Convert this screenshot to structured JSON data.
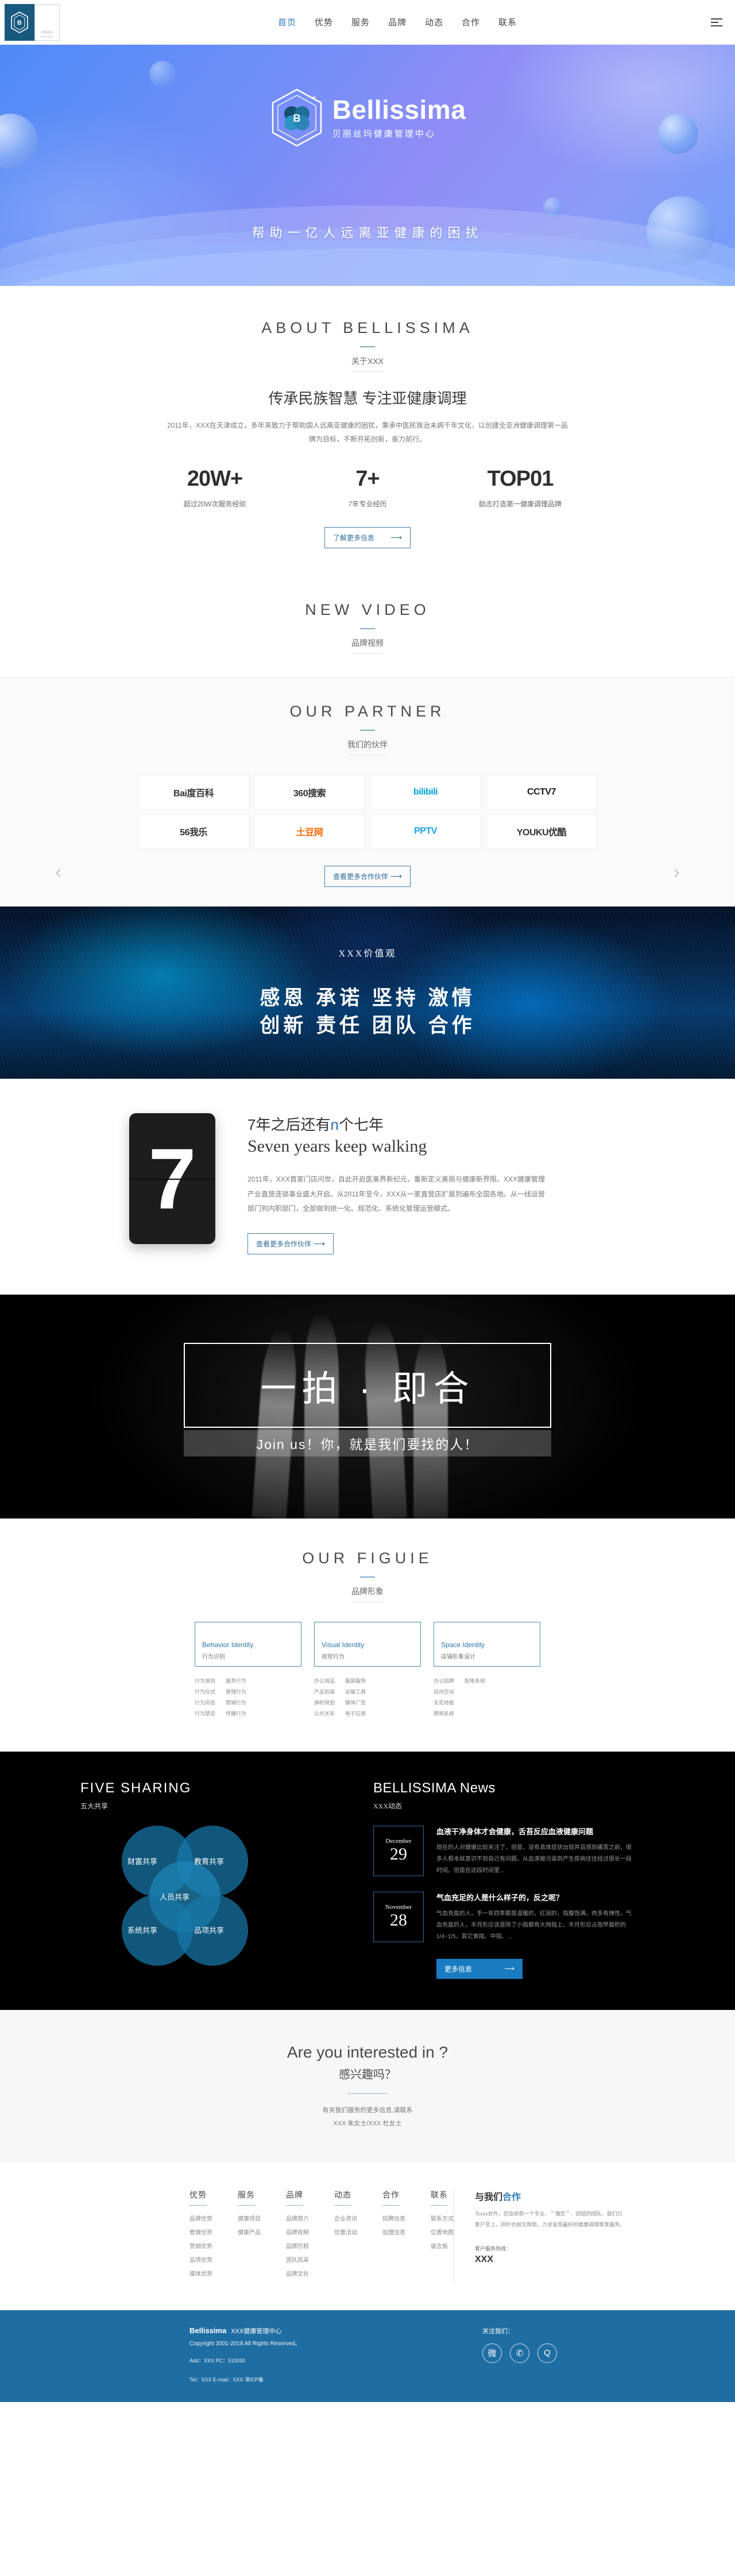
{
  "header": {
    "logo_brand": "Bellissima",
    "logo_cn": "贝丽丝玛",
    "logo_since": "Since 2011",
    "nav": [
      {
        "label": "首页",
        "active": true
      },
      {
        "label": "优势",
        "active": false
      },
      {
        "label": "服务",
        "active": false
      },
      {
        "label": "品牌",
        "active": false
      },
      {
        "label": "动态",
        "active": false
      },
      {
        "label": "合作",
        "active": false
      },
      {
        "label": "联系",
        "active": false
      }
    ]
  },
  "hero": {
    "brand_name": "Bellissima",
    "brand_cn": "贝丽丝玛健康管理中心",
    "slogan": "帮助一亿人远离亚健康的困扰"
  },
  "about": {
    "title": "ABOUT BELLISSIMA",
    "subtitle": "关于XXX",
    "heading": "传承民族智慧 专注亚健康调理",
    "desc": "2011年，XXX在天津成立，多年来致力于帮助国人远离亚健康的困扰，秉承中医民族治未病千年文化，以创建全亚洲健康调理第一品牌为目标，不断开拓创新，奋力前行。",
    "stats": [
      {
        "num": "20W+",
        "cap": "超过20W次服务经验"
      },
      {
        "num": "7+",
        "cap": "7年专业经历"
      },
      {
        "num": "TOP01",
        "cap": "励志打造第一健康调理品牌"
      }
    ],
    "button": "了解更多信息",
    "button_arrow": "⟶"
  },
  "video": {
    "title": "NEW VIDEO",
    "subtitle": "品牌视频"
  },
  "partner": {
    "title": "OUR PARTNER",
    "subtitle": "我们的伙伴",
    "prev_icon": "‹",
    "next_icon": "›",
    "logos": [
      {
        "name": "baidu-baike-logo",
        "text": "Bai度百科"
      },
      {
        "name": "360-search-logo",
        "text": "360搜索"
      },
      {
        "name": "bilibili-logo",
        "text": "bilibili"
      },
      {
        "name": "cctv7-logo",
        "text": "CCTV7"
      },
      {
        "name": "56-wole-logo",
        "text": "56我乐"
      },
      {
        "name": "tudou-logo",
        "text": "土豆网"
      },
      {
        "name": "pptv-logo",
        "text": "PPTV"
      },
      {
        "name": "youku-logo",
        "text": "YOUKU优酷"
      }
    ],
    "button": "查看更多合作伙伴",
    "button_arrow": "⟶"
  },
  "values": {
    "kicker": "XXX价值观",
    "line1": "感恩 承诺 坚持 激情",
    "line2": "创新 责任 团队 合作"
  },
  "seven": {
    "flip_number": "7",
    "heading_a": "7年之后还有",
    "heading_em": "n",
    "heading_b": "个七年",
    "subheading": "Seven years keep walking",
    "desc": "2011年，XXX首家门店问世，自此开启医美界新纪元，重新定义美丽与健康新界限。XXX健康管理产业直营连锁事业盛大开启。从2011年至今，XXX从一家直营店扩展到遍布全国各地。从一线运营部门到内职部门，全部做到统一化、规范化、系统化管理运营模式。",
    "button": "查看更多合作伙伴",
    "button_arrow": "⟶"
  },
  "join": {
    "headline": "一拍 · 即合",
    "caption": "Join us！你，就是我们要找的人！"
  },
  "figure": {
    "title": "OUR FIGUIE",
    "subtitle": "品牌形象",
    "cards": [
      {
        "en": "Behavior Identity",
        "cn": "行为识别",
        "col1": [
          "行为准则",
          "行为仪式",
          "行为风俗",
          "行为禁忌"
        ],
        "col2": [
          "服务行为",
          "管理行为",
          "营销行为",
          "传播行为"
        ]
      },
      {
        "en": "Visual Identity",
        "cn": "视觉行为",
        "col1": [
          "办公用品",
          "产品包装",
          "旗帜规划",
          "公共关系"
        ],
        "col2": [
          "服装服饰",
          "运输工具",
          "媒体广告",
          "电子应用"
        ]
      },
      {
        "en": "Space Identity",
        "cn": "店铺形象设计",
        "col1": [
          "办公招牌",
          "店内空间",
          "天花地板",
          "照明系统"
        ],
        "col2": [
          "配电系统"
        ]
      }
    ]
  },
  "five_sharing": {
    "title": "FIVE SHARING",
    "subtitle": "五大共享",
    "circles": [
      "财富共享",
      "教育共享",
      "人员共享",
      "系统共享",
      "品项共享"
    ]
  },
  "news": {
    "title": "BELLISSIMA News",
    "subtitle": "XXX动态",
    "items": [
      {
        "month": "December",
        "day": "29",
        "title": "血液干净身体才会健康，舌苔反应血液健康问题",
        "excerpt": "现在的人对健康比较关注了，但是，没有具体症状出现并且感到痛苦之前，很多人根本就意识不到自己有问题。从血液被污染到产生疾病往往经过很长一段时间。但是在这段时间里..."
      },
      {
        "month": "November",
        "day": "28",
        "title": "气血充足的人是什么样子的，反之呢？",
        "excerpt": "气血充盈的人，手一年四季都是温暖的，红润的，指腹饱满。肉多有弹性。气血充盈的人，半月形应该是除了小指都有大拇指上，半月形应占指甲面积的1/4~1/5，其它食指、中指、..."
      }
    ],
    "button": "更多信息",
    "button_arrow": "⟶"
  },
  "interest": {
    "title": "Are you interested in ?",
    "subtitle": "感兴趣吗？",
    "line1": "有关我们服务的更多信息,请联系",
    "line2": "XXX 朱女士/XXX 杜女士"
  },
  "footer": {
    "columns": [
      {
        "head": "优势",
        "items": [
          "品牌优势",
          "管理优势",
          "营销优势",
          "品项优势",
          "媒体优势"
        ]
      },
      {
        "head": "服务",
        "items": [
          "健康项目",
          "健康产品"
        ]
      },
      {
        "head": "品牌",
        "items": [
          "品牌简介",
          "品牌视频",
          "品牌历程",
          "团队风采",
          "品牌文化"
        ]
      },
      {
        "head": "动态",
        "items": [
          "企业资讯",
          "优惠活动"
        ]
      },
      {
        "head": "合作",
        "items": [
          "招聘信息",
          "加盟信息"
        ]
      },
      {
        "head": "联系",
        "items": [
          "联系方式",
          "位置地图",
          "留言板"
        ]
      }
    ],
    "right": {
      "title_a": "与我们",
      "title_b": "合作",
      "desc": "与xxx合作，您会收获一个专业、＂懂您＂、团结的团队。我们已客户至上，同时也相互帮助，力求呈现最好的健康调理尊享服务。",
      "hotline_label": "客户服务热线：",
      "hotline": "XXX"
    }
  },
  "copyright": {
    "brand": "Bellissima",
    "brand_cn": "XXX健康管理中心",
    "copy": "Copyright 2001-2018 All Rights Reserved。",
    "addr": "Add：XXX   PC：510030",
    "tel": "Tel：XXX    E-mail：XXX  津ICP备",
    "follow_label": "关注我们：",
    "socials": [
      {
        "name": "weibo-icon",
        "glyph": "微"
      },
      {
        "name": "wechat-icon",
        "glyph": "✆"
      },
      {
        "name": "qq-icon",
        "glyph": "Q"
      }
    ]
  },
  "colors": {
    "brand_blue": "#1f6ea3",
    "accent": "#2d7bb5",
    "rule": "#7fa9c4"
  }
}
